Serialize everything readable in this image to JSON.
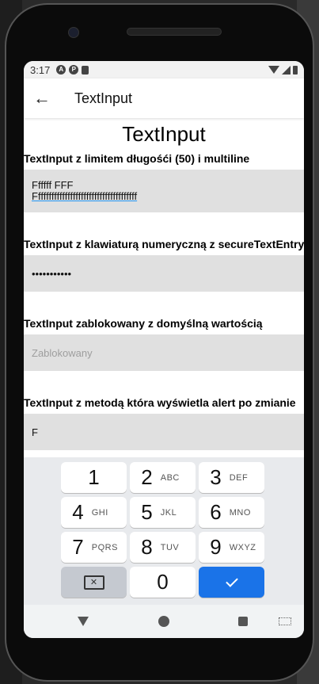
{
  "status_bar": {
    "time": "3:17",
    "notification_icons": [
      "a-icon",
      "p-icon",
      "sd-card-icon"
    ],
    "system_icons": [
      "wifi-icon",
      "signal-icon",
      "battery-icon"
    ]
  },
  "app_bar": {
    "back_icon": "arrow-left-icon",
    "title": "TextInput"
  },
  "page": {
    "title": "TextInput",
    "sections": [
      {
        "label": "TextInput z limitem długośći (50) i multiline",
        "value_line1": "Ffffff FFF",
        "value_line2": "Ffffffffffffffffffffffffffffffffffffff"
      },
      {
        "label": "TextInput z klawiaturą numeryczną z secureTextEntry",
        "value": "•••••••••••"
      },
      {
        "label": "TextInput zablokowany z domyślną wartością",
        "value": "Zablokowany"
      },
      {
        "label": "TextInput z metodą która wyświetla alert po zmianie",
        "value": "F"
      }
    ]
  },
  "keyboard": {
    "rows": [
      [
        {
          "digit": "1",
          "letters": ""
        },
        {
          "digit": "2",
          "letters": "ABC"
        },
        {
          "digit": "3",
          "letters": "DEF"
        }
      ],
      [
        {
          "digit": "4",
          "letters": "GHI"
        },
        {
          "digit": "5",
          "letters": "JKL"
        },
        {
          "digit": "6",
          "letters": "MNO"
        }
      ],
      [
        {
          "digit": "7",
          "letters": "PQRS"
        },
        {
          "digit": "8",
          "letters": "TUV"
        },
        {
          "digit": "9",
          "letters": "WXYZ"
        }
      ]
    ],
    "bottom_row": {
      "delete_icon": "backspace-icon",
      "zero": "0",
      "done_icon": "checkmark-icon"
    },
    "colors": {
      "done_key": "#1a73e8",
      "delete_key": "#c5c9d0"
    }
  },
  "nav_bar": {
    "icons": [
      "back-triangle-icon",
      "home-circle-icon",
      "recents-square-icon",
      "keyboard-switch-icon"
    ]
  }
}
